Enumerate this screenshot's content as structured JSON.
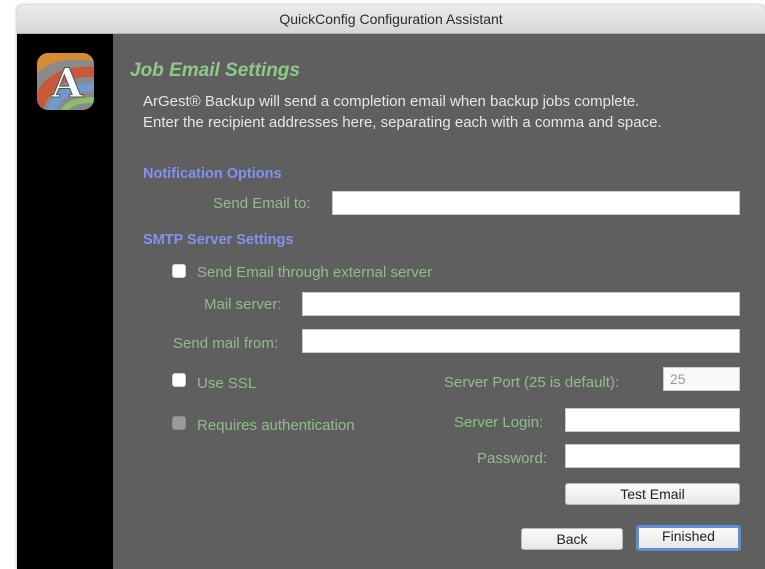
{
  "window": {
    "title": "QuickConfig Configuration Assistant"
  },
  "logo": {
    "letter": "A"
  },
  "page": {
    "heading": "Job Email Settings",
    "intro_line1": "ArGest® Backup will send a completion email when backup jobs complete.",
    "intro_line2": "Enter the recipient addresses here, separating each with a comma and space."
  },
  "notification": {
    "section_title": "Notification Options",
    "send_email_label": "Send Email to:",
    "send_email_value": ""
  },
  "smtp": {
    "section_title": "SMTP Server Settings",
    "external_server_label": "Send Email through external server",
    "external_server_checked": false,
    "mail_server_label": "Mail server:",
    "mail_server_value": "",
    "send_from_label": "Send mail from:",
    "send_from_value": "",
    "use_ssl_label": "Use SSL",
    "use_ssl_checked": false,
    "server_port_label": "Server Port (25 is default):",
    "server_port_value": "25",
    "requires_auth_label": "Requires authentication",
    "requires_auth_checked": false,
    "server_login_label": "Server Login:",
    "server_login_value": "",
    "password_label": "Password:",
    "password_value": "",
    "test_email_label": "Test Email"
  },
  "footer": {
    "back_label": "Back",
    "finished_label": "Finished"
  },
  "colors": {
    "heading": "#8ec98a",
    "label": "#8fbf88",
    "section": "#7f93f0",
    "panel": "#5f5f5f",
    "sidebar": "#000000",
    "focus": "#5b8fd6"
  }
}
